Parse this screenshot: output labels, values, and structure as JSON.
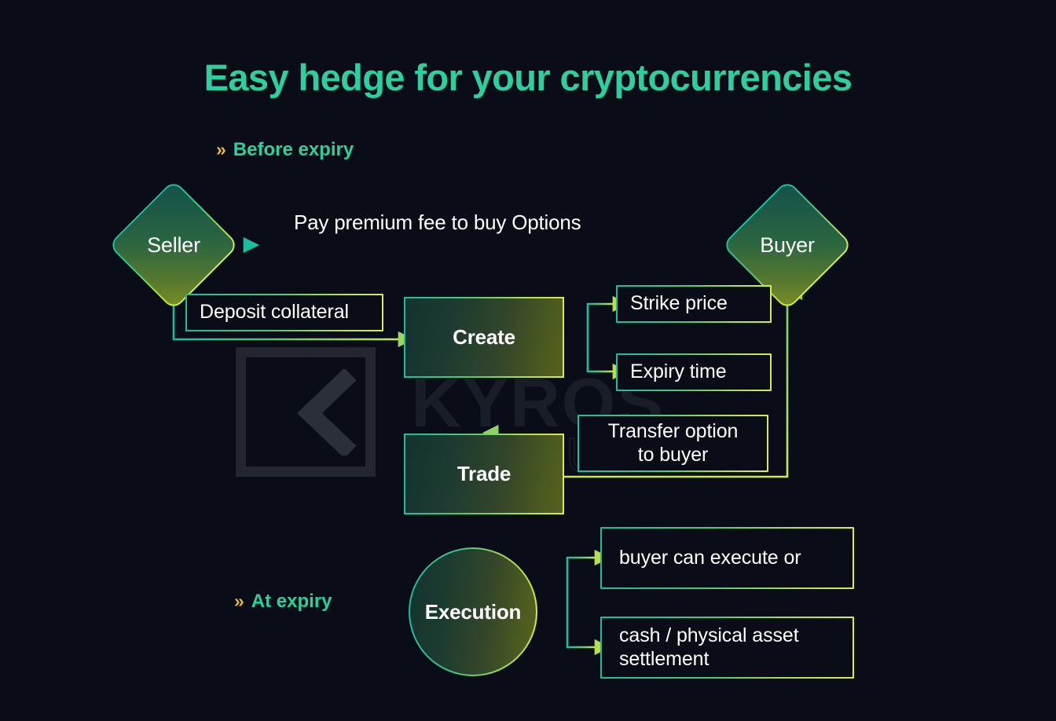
{
  "theme": {
    "background": "#0a0d18",
    "accent_teal": "#2ecf9e",
    "accent_yellow": "#e5b93c",
    "gradient_start": "#1bbd9c",
    "gradient_end": "#d8ec4a",
    "text_white": "#ffffff"
  },
  "page_title": "Easy hedge for your cryptocurrencies",
  "sections": {
    "before_expiry": {
      "chevron": "»",
      "label": "Before expiry"
    },
    "at_expiry": {
      "chevron": "»",
      "label": "At expiry"
    }
  },
  "nodes": {
    "seller": "Seller",
    "buyer": "Buyer",
    "create": "Create",
    "trade": "Trade",
    "execution": "Execution",
    "deposit_collateral": "Deposit collateral",
    "strike_price": "Strike price",
    "expiry_time": "Expiry time",
    "transfer_option": "Transfer option\nto buyer",
    "transfer_option_line1": "Transfer option",
    "transfer_option_line2": "to buyer",
    "buyer_execute": "buyer can execute or",
    "settlement_line1": "cash /  physical asset",
    "settlement_line2": "settlement"
  },
  "edges": {
    "pay_premium": "Pay premium fee to buy Options"
  },
  "watermark": {
    "brand": "KYROS",
    "sub": "VENTURES",
    "icon": "chevron-left-icon"
  }
}
